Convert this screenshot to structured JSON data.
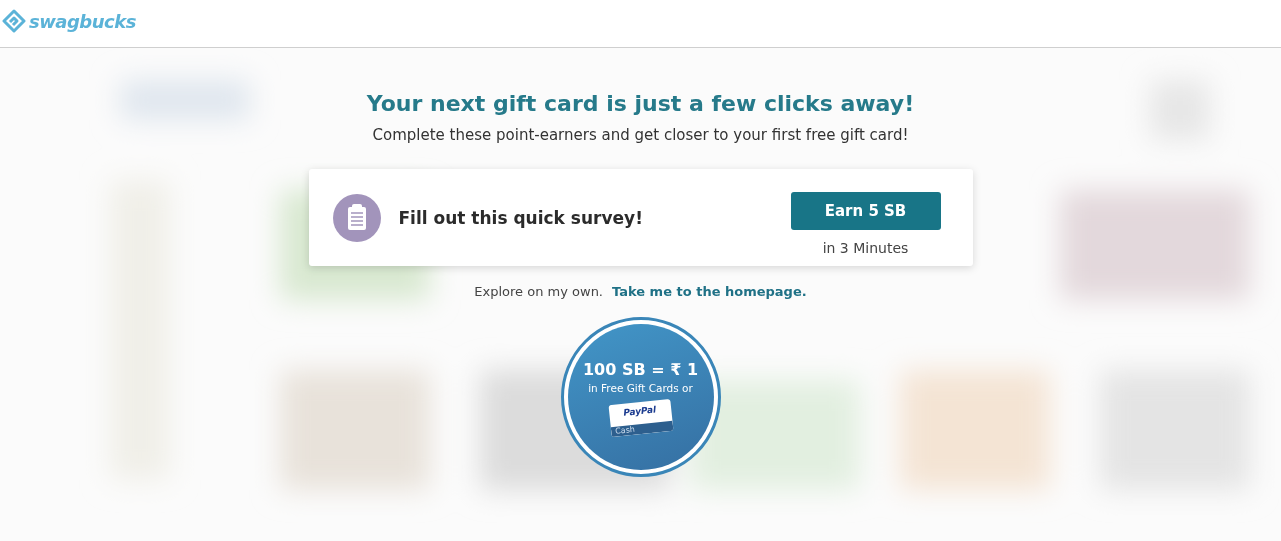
{
  "header": {
    "logo_text": "swagbucks"
  },
  "heading": "Your next gift card is just a few clicks away!",
  "subheading": "Complete these point-earners and get closer to your first free gift card!",
  "offer": {
    "title": "Fill out this quick survey!",
    "button": "Earn 5 SB",
    "duration": "in 3 Minutes"
  },
  "explore": {
    "text": "Explore on my own.",
    "link": "Take me to the homepage."
  },
  "badge": {
    "rate": "100 SB = ₹ 1",
    "caption": "in Free Gift Cards or",
    "card_brand": "PayPal",
    "card_label": "Cash"
  }
}
